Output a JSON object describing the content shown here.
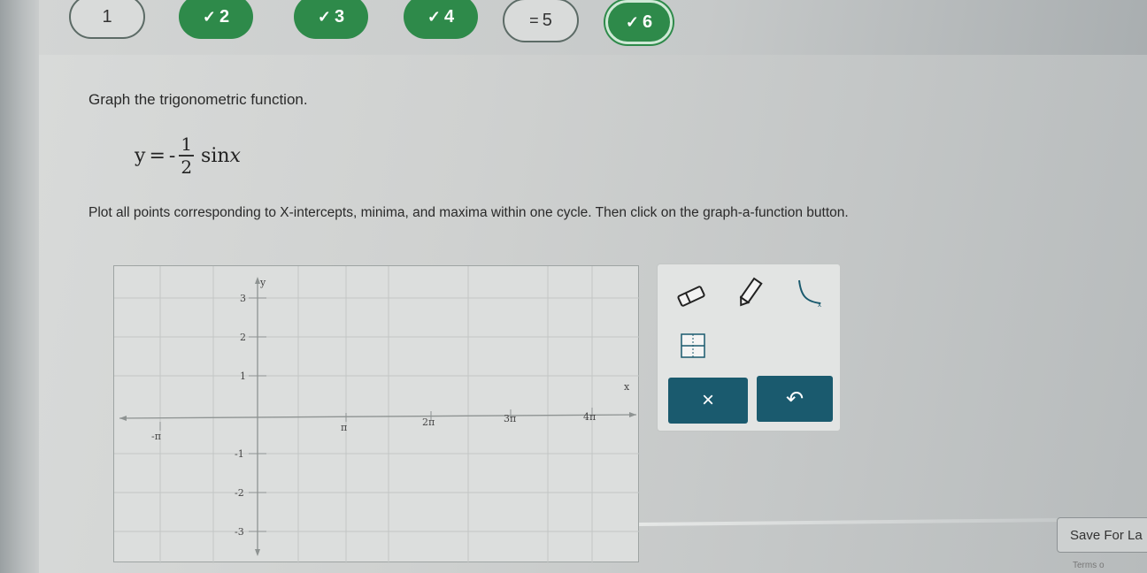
{
  "progress": {
    "steps": [
      {
        "label": "1",
        "status": "plain",
        "check": ""
      },
      {
        "label": "2",
        "status": "done",
        "check": "✓"
      },
      {
        "label": "3",
        "status": "done",
        "check": "✓"
      },
      {
        "label": "4",
        "status": "done",
        "check": "✓"
      },
      {
        "label": "5",
        "status": "plain",
        "check": "="
      },
      {
        "label": "6",
        "status": "current",
        "check": "✓"
      }
    ]
  },
  "question": {
    "instruction": "Graph the trigonometric function.",
    "equation": {
      "lhs": "y",
      "eq": "=",
      "sign": "-",
      "num": "1",
      "den": "2",
      "func": "sin",
      "var": "x"
    },
    "plot_instruction": "Plot all points corresponding to X-intercepts, minima, and maxima within one cycle. Then click on the graph-a-function button."
  },
  "graph": {
    "x_axis_label": "x",
    "y_axis_label": "y",
    "x_ticks": [
      "-π",
      "π",
      "2π",
      "3π",
      "4π"
    ],
    "y_ticks": [
      "3",
      "2",
      "1",
      "-1",
      "-2",
      "-3"
    ]
  },
  "toolbar": {
    "tools": [
      "eraser-icon",
      "pencil-icon",
      "graph-function-icon",
      "fraction-icon"
    ],
    "clear_label": "×",
    "undo_label": "↶"
  },
  "footer": {
    "save_label": "Save For La",
    "terms_text": "Terms o"
  },
  "colors": {
    "done": "#2e8a4a",
    "button": "#1a5a6e"
  }
}
